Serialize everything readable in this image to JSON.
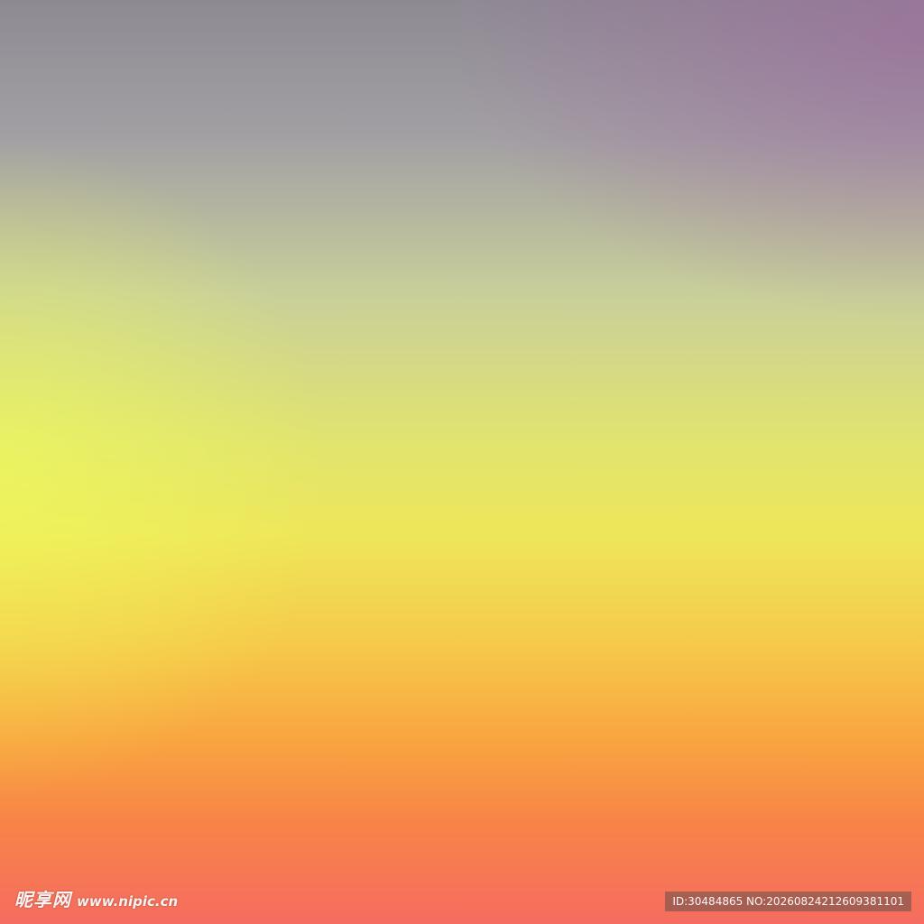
{
  "background": {
    "colors": [
      "#8e8a93",
      "#a3a0a4",
      "#c9cf9a",
      "#e1e46e",
      "#eee65a",
      "#f6c94a",
      "#f9a540",
      "#f88448",
      "#f56c60"
    ]
  },
  "watermark": {
    "site_name": "昵享网",
    "site_url": "www.nipic.cn",
    "id_text": "ID:30484865 NO:20260824212609381101"
  }
}
